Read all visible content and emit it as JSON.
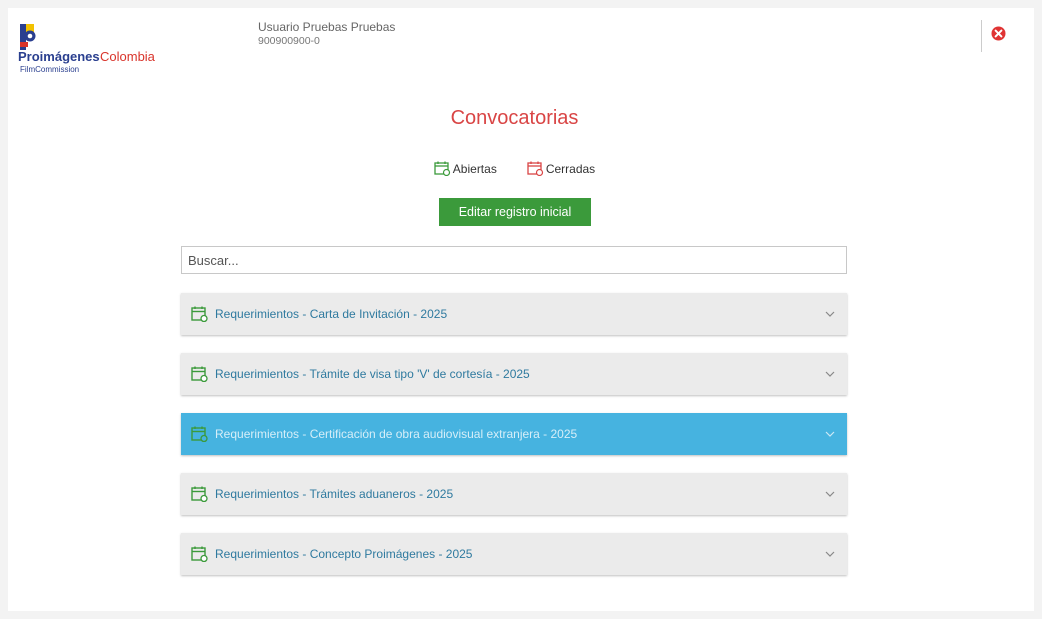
{
  "header": {
    "logo": {
      "brand_main": "Proimágenes",
      "brand_accent": "Colombia",
      "brand_sub": "FilmCommission"
    },
    "user_name": "Usuario Pruebas Pruebas",
    "user_id": "900900900-0"
  },
  "main": {
    "title": "Convocatorias",
    "legend": {
      "open_label": "Abiertas",
      "closed_label": "Cerradas"
    },
    "edit_button_label": "Editar registro inicial",
    "search_placeholder": "Buscar...",
    "items": [
      {
        "label": "Requerimientos - Carta de Invitación - 2025",
        "status": "open",
        "active": false
      },
      {
        "label": "Requerimientos - Trámite de visa tipo 'V' de cortesía - 2025",
        "status": "open",
        "active": false
      },
      {
        "label": "Requerimientos - Certificación de obra audiovisual extranjera - 2025",
        "status": "open",
        "active": true
      },
      {
        "label": "Requerimientos - Trámites aduaneros - 2025",
        "status": "open",
        "active": false
      },
      {
        "label": "Requerimientos - Concepto Proimágenes - 2025",
        "status": "open",
        "active": false
      }
    ]
  },
  "colors": {
    "title": "#d94545",
    "open_icon": "#3b9a3b",
    "closed_icon": "#d94545",
    "active_item": "#46b3e0",
    "button": "#3b9a3b"
  }
}
